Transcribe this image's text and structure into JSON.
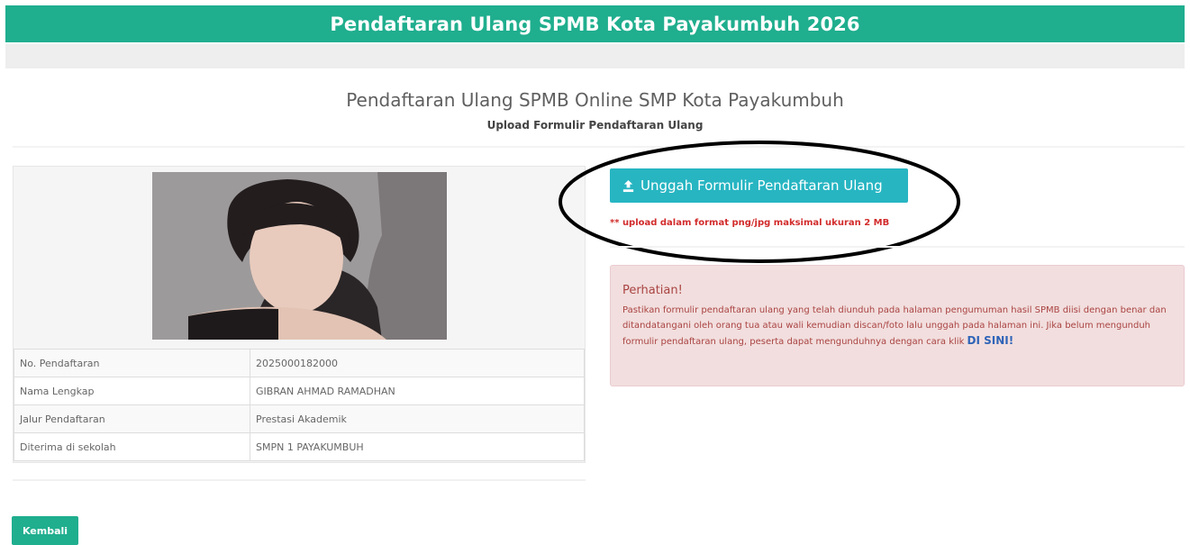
{
  "header": {
    "title": "Pendaftaran Ulang SPMB Kota Payakumbuh 2026"
  },
  "page": {
    "title": "Pendaftaran Ulang SPMB Online SMP Kota Payakumbuh",
    "subtitle": "Upload Formulir Pendaftaran Ulang"
  },
  "profile": {
    "photo_icon": "student-photo",
    "rows": [
      {
        "label": "No. Pendaftaran",
        "value": "2025000182000"
      },
      {
        "label": "Nama Lengkap",
        "value": "GIBRAN AHMAD RAMADHAN"
      },
      {
        "label": "Jalur Pendaftaran",
        "value": "Prestasi Akademik"
      },
      {
        "label": "Diterima di sekolah",
        "value": "SMPN 1 PAYAKUMBUH"
      }
    ]
  },
  "upload": {
    "button_label": "Unggah Formulir Pendaftaran Ulang",
    "button_icon": "upload-icon",
    "note": "** upload dalam format png/jpg maksimal ukuran 2 MB"
  },
  "alert": {
    "title": "Perhatian!",
    "body": "Pastikan formulir pendaftaran ulang yang telah diunduh pada halaman pengumuman hasil SPMB diisi dengan benar dan ditandatangani oleh orang tua atau wali kemudian discan/foto lalu unggah pada halaman ini. Jika belum mengunduh formulir pendaftaran ulang, peserta dapat mengunduhnya dengan cara klik",
    "link_label": "DI SINI!"
  },
  "footer": {
    "back_label": "Kembali"
  },
  "colors": {
    "primary": "#1fae8e",
    "upload_button": "#27b5c2",
    "note_red": "#d22b2b",
    "alert_bg": "#f2dede",
    "alert_text": "#a94442",
    "link": "#2f64b8"
  }
}
